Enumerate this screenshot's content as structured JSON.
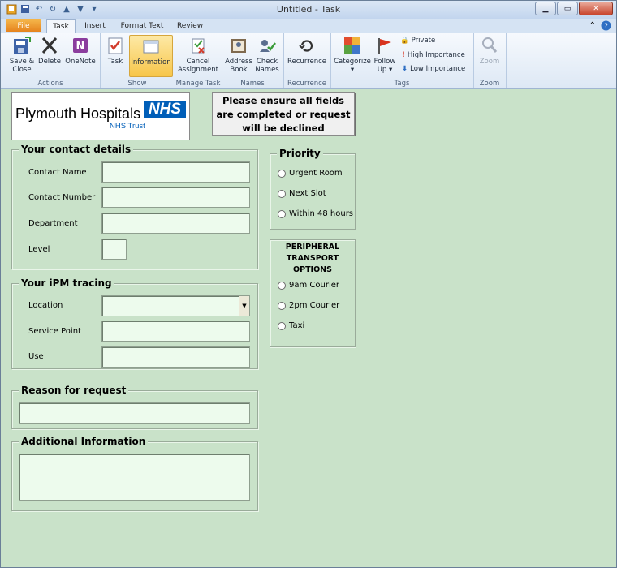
{
  "window": {
    "title": "Untitled - Task"
  },
  "tabs": [
    "File",
    "Task",
    "Insert",
    "Format Text",
    "Review"
  ],
  "ribbon": {
    "actions": {
      "label": "Actions",
      "save_close": "Save &",
      "save_close2": "Close",
      "delete": "Delete",
      "onenote": "OneNote"
    },
    "show": {
      "label": "Show",
      "task": "Task",
      "information": "Information"
    },
    "manage": {
      "label": "Manage Task",
      "cancel": "Cancel",
      "cancel2": "Assignment"
    },
    "names": {
      "label": "Names",
      "address": "Address",
      "address2": "Book",
      "check": "Check",
      "check2": "Names"
    },
    "recurrence": {
      "label": "Recurrence",
      "recurrence": "Recurrence"
    },
    "tags": {
      "label": "Tags",
      "categorize": "Categorize",
      "follow": "Follow",
      "follow2": "Up",
      "private": "Private",
      "high": "High Importance",
      "low": "Low Importance"
    },
    "zoom": {
      "label": "Zoom",
      "zoom": "Zoom"
    }
  },
  "form": {
    "nhs": {
      "name": "Plymouth Hospitals",
      "logo": "NHS",
      "trust": "NHS Trust"
    },
    "notice": "Please ensure all fields are completed or request will be declined",
    "contact": {
      "legend": "Your contact details",
      "name": "Contact Name",
      "number": "Contact Number",
      "department": "Department",
      "level": "Level"
    },
    "ipm": {
      "legend": "Your iPM tracing",
      "location": "Location",
      "service_point": "Service Point",
      "use": "Use"
    },
    "reason": {
      "legend": "Reason for request"
    },
    "additional": {
      "legend": "Additional Information"
    },
    "priority": {
      "legend": "Priority",
      "options": [
        "Urgent Room",
        "Next Slot",
        "Within 48 hours"
      ]
    },
    "transport": {
      "title1": "PERIPHERAL",
      "title2": "TRANSPORT OPTIONS",
      "options": [
        "9am Courier",
        "2pm Courier",
        "Taxi"
      ]
    }
  },
  "colors": {
    "background": "#c9e2c9",
    "nhs_blue": "#005eb8",
    "file_tab": "#e5801b"
  }
}
